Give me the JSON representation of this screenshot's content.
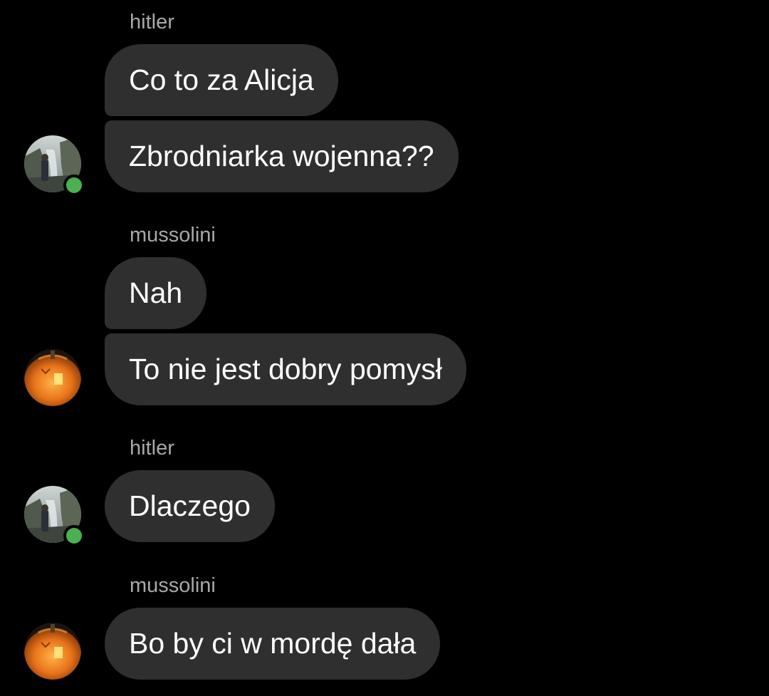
{
  "messages": [
    {
      "sender": "hitler",
      "avatar": "hitler-avatar",
      "online": true,
      "bubbles": [
        "Co to za Alicja",
        "Zbrodniarka wojenna??"
      ]
    },
    {
      "sender": "mussolini",
      "avatar": "pumpkin-avatar",
      "online": false,
      "bubbles": [
        "Nah",
        "To nie jest dobry pomysł"
      ]
    },
    {
      "sender": "hitler",
      "avatar": "hitler-avatar",
      "online": true,
      "bubbles": [
        "Dlaczego"
      ]
    },
    {
      "sender": "mussolini",
      "avatar": "pumpkin-avatar",
      "online": false,
      "bubbles": [
        "Bo by ci w mordę dała"
      ]
    }
  ],
  "colors": {
    "background": "#000000",
    "bubble": "#2f2f2f",
    "sender_text": "#a8a8a8",
    "online_indicator": "#4caf50"
  }
}
